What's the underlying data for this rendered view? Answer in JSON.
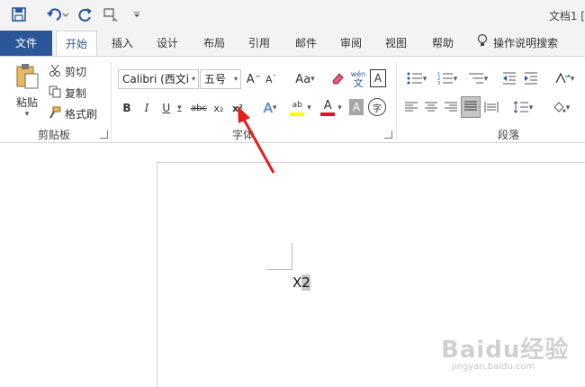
{
  "titlebar": {
    "doc_title": "文档1 [",
    "qat": {
      "save_icon": "save-icon",
      "undo_icon": "undo-icon",
      "redo_icon": "redo-icon",
      "customize_icon": "customize-icon"
    }
  },
  "tabs": [
    {
      "label": "文件"
    },
    {
      "label": "开始"
    },
    {
      "label": "插入"
    },
    {
      "label": "设计"
    },
    {
      "label": "布局"
    },
    {
      "label": "引用"
    },
    {
      "label": "邮件"
    },
    {
      "label": "审阅"
    },
    {
      "label": "视图"
    },
    {
      "label": "帮助"
    },
    {
      "label": "操作说明搜索"
    }
  ],
  "clipboard": {
    "paste_label": "粘贴",
    "cut_label": "剪切",
    "copy_label": "复制",
    "format_painter_label": "格式刷",
    "group_label": "剪贴板"
  },
  "font": {
    "font_name": "Calibri (西文i",
    "font_size": "五号",
    "grow_label": "A",
    "shrink_label": "A",
    "case_label": "Aa",
    "pinyin_label": "wén",
    "pinyin_char": "文",
    "border_label": "A",
    "bold_label": "B",
    "italic_label": "I",
    "underline_label": "U",
    "strike_label": "abc",
    "subscript_label": "x₂",
    "superscript_label": "x²",
    "text_effect_label": "A",
    "highlight_label": "ab",
    "font_color_label": "A",
    "shading_label": "A",
    "enclose_label": "字",
    "group_label": "字体"
  },
  "paragraph": {
    "group_label": "段落"
  },
  "document": {
    "text": "X",
    "selected_text": "2"
  },
  "watermark": {
    "logo_text": "Baidu经验",
    "url_text": "jingyan.baidu.com"
  },
  "colors": {
    "accent": "#2b579a",
    "arrow": "#e0201c",
    "highlight_yellow": "#ffff00",
    "font_red": "#e81123"
  }
}
